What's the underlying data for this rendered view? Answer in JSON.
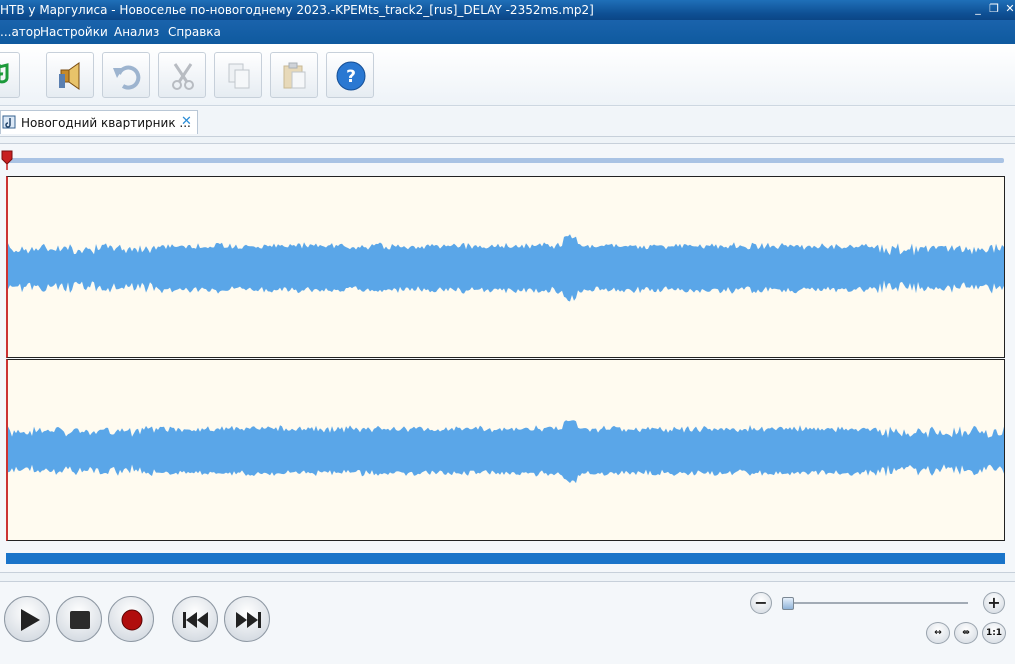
{
  "window": {
    "title": "НТВ у Маргулиса - Новоселье по-новогоднему 2023.-KPEMts_track2_[rus]_DELAY -2352ms.mp2]",
    "minimize": "_",
    "restore": "❐",
    "close": "✕"
  },
  "menu": {
    "items": [
      "...атор",
      "Настройки",
      "Анализ",
      "Справка"
    ]
  },
  "toolbar": {
    "buttons": [
      "music-note-icon",
      "speaker-icon",
      "undo-icon",
      "scissors-icon",
      "copy-icon",
      "paste-icon",
      "help-icon"
    ],
    "help_label": "?"
  },
  "tabs": [
    {
      "label": "Новогодний квартирник ...",
      "close": "✕"
    }
  ],
  "colors": {
    "wave": "#5aa6e8",
    "panel": "#fffbf0",
    "progress": "#1a74c9",
    "accent": "#0f5a9f"
  },
  "zoom": {
    "minus": "−",
    "plus": "+",
    "level": 0.0,
    "fit_label": "↔",
    "selection_label": "⇹",
    "one_to_one": "1:1"
  }
}
